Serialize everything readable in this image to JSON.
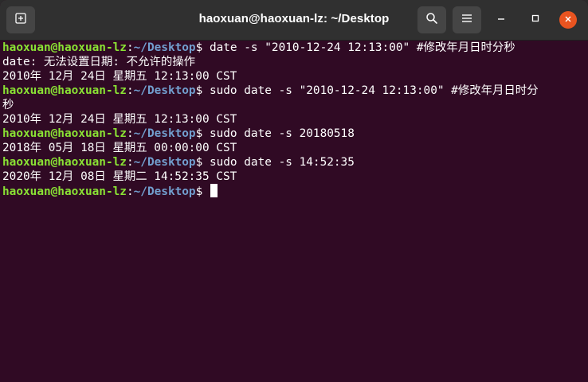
{
  "window": {
    "title": "haoxuan@haoxuan-lz: ~/Desktop"
  },
  "toolbar": {
    "new_tab_icon": "new-tab-icon",
    "search_icon": "search-icon",
    "menu_icon": "hamburger-menu-icon",
    "minimize_icon": "minimize-icon",
    "maximize_icon": "maximize-icon",
    "close_icon": "close-icon"
  },
  "colors": {
    "terminal_bg": "#300a24",
    "prompt_user": "#8ae234",
    "prompt_path": "#729fcf",
    "close_button": "#e95420"
  },
  "prompt": {
    "user": "haoxuan@haoxuan-lz",
    "colon": ":",
    "path": "~/Desktop",
    "symbol": "$"
  },
  "terminal": {
    "lines": [
      {
        "type": "cmd",
        "text": " date -s \"2010-12-24 12:13:00\" #修改年月日时分秒"
      },
      {
        "type": "out",
        "text": "date: 无法设置日期: 不允许的操作"
      },
      {
        "type": "out",
        "text": "2010年 12月 24日 星期五 12:13:00 CST"
      },
      {
        "type": "cmd",
        "text": " sudo date -s \"2010-12-24 12:13:00\" #修改年月日时分"
      },
      {
        "type": "out",
        "text": "秒"
      },
      {
        "type": "out",
        "text": "2010年 12月 24日 星期五 12:13:00 CST"
      },
      {
        "type": "cmd",
        "text": " sudo date -s 20180518"
      },
      {
        "type": "out",
        "text": "2018年 05月 18日 星期五 00:00:00 CST"
      },
      {
        "type": "cmd",
        "text": " sudo date -s 14:52:35"
      },
      {
        "type": "out",
        "text": "2020年 12月 08日 星期二 14:52:35 CST"
      },
      {
        "type": "cmd",
        "text": " "
      }
    ]
  }
}
